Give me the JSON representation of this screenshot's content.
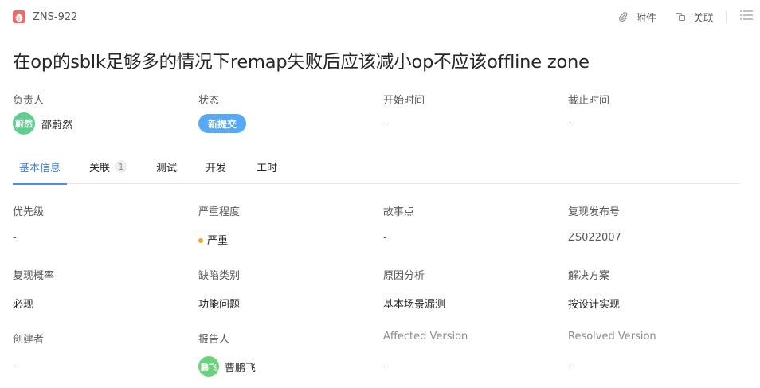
{
  "issue": {
    "key": "ZNS-922",
    "title": "在op的sblk足够多的情况下remap失败后应该减小op不应该offline zone"
  },
  "header_actions": {
    "attachment_label": "附件",
    "relation_label": "关联"
  },
  "meta": {
    "assignee_label": "负责人",
    "assignee_avatar": "蔚然",
    "assignee_name": "邵蔚然",
    "status_label": "状态",
    "status_value": "新提交",
    "start_label": "开始时间",
    "start_value": "-",
    "due_label": "截止时间",
    "due_value": "-"
  },
  "tabs": [
    {
      "label": "基本信息",
      "active": true
    },
    {
      "label": "关联",
      "count": "1"
    },
    {
      "label": "测试"
    },
    {
      "label": "开发"
    },
    {
      "label": "工时"
    }
  ],
  "fields": {
    "priority": {
      "label": "优先级",
      "value": "-"
    },
    "severity": {
      "label": "严重程度",
      "value": "严重"
    },
    "story": {
      "label": "故事点",
      "value": "-"
    },
    "repro_release": {
      "label": "复现发布号",
      "value": "ZS022007"
    },
    "repro_rate": {
      "label": "复现概率",
      "value": "必现"
    },
    "defect_type": {
      "label": "缺陷类别",
      "value": "功能问题"
    },
    "root_cause": {
      "label": "原因分析",
      "value": "基本场景漏测"
    },
    "solution": {
      "label": "解决方案",
      "value": "按设计实现"
    },
    "creator": {
      "label": "创建者",
      "value": "-"
    },
    "reporter": {
      "label": "报告人",
      "avatar": "鹏飞",
      "value": "曹鹏飞"
    },
    "affected_version": {
      "label": "Affected Version",
      "value": "-"
    },
    "resolved_version": {
      "label": "Resolved Version",
      "value": "-"
    }
  },
  "colors": {
    "bug_icon": "#f06a6a",
    "status_pill": "#57a9f6",
    "active_tab": "#3d7fd9",
    "severity_dot": "#f5a623",
    "avatar": "#5fcf8e"
  },
  "icons": {
    "issue_type": "bug-icon",
    "attachment": "paperclip-icon",
    "relation": "link-copy-icon",
    "menu": "list-icon"
  }
}
